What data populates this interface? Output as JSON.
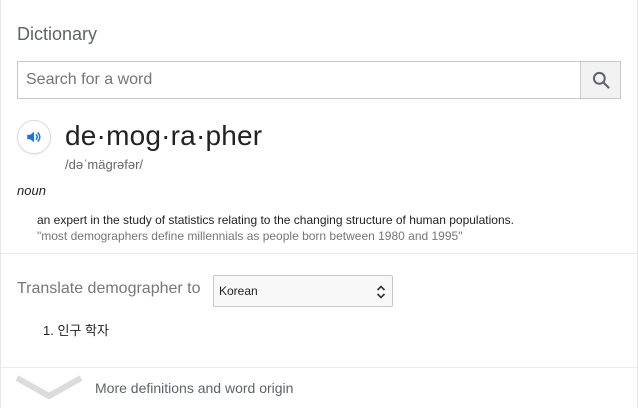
{
  "header": {
    "title": "Dictionary"
  },
  "search": {
    "placeholder": "Search for a word",
    "value": "",
    "button_icon": "search-icon"
  },
  "entry": {
    "speaker_icon": "speaker-icon",
    "word": "de·mog·ra·pher",
    "phonetic": "/dəˈmäɡrəfər/",
    "part_of_speech": "noun",
    "definition": "an expert in the study of statistics relating to the changing structure of human populations.",
    "example": "\"most demographers define millennials as people born between 1980 and 1995\""
  },
  "translate": {
    "label": "Translate demographer to",
    "selected_language": "Korean",
    "results": [
      "1. 인구 학자"
    ]
  },
  "footer": {
    "more_label": "More definitions and word origin",
    "chevron_icon": "chevron-down-icon"
  },
  "colors": {
    "accent_blue": "#1a73e8",
    "muted_text": "#777777",
    "divider": "#ebebeb"
  }
}
